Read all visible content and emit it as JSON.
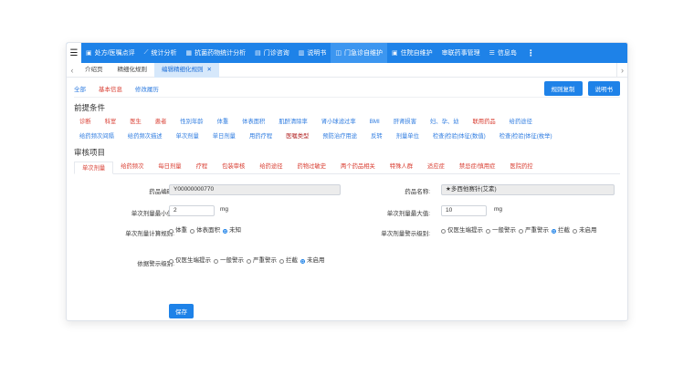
{
  "nav": {
    "items": [
      {
        "icon": "prescription-icon",
        "glyph": "▣",
        "label": "处方/医嘱点评"
      },
      {
        "icon": "chart-icon",
        "glyph": "⟋",
        "label": "统计分析"
      },
      {
        "icon": "antibiotic-icon",
        "glyph": "▦",
        "label": "抗菌药物统计分析"
      },
      {
        "icon": "clinic-icon",
        "glyph": "▤",
        "label": "门诊咨询"
      },
      {
        "icon": "manual-icon",
        "glyph": "▥",
        "label": "说明书"
      },
      {
        "icon": "outpatient-icon",
        "glyph": "◫",
        "label": "门急诊自维护"
      },
      {
        "icon": "inpatient-icon",
        "glyph": "▣",
        "label": "住院自维护"
      },
      {
        "icon": "none",
        "glyph": "",
        "label": "审联药事管理"
      },
      {
        "icon": "info-icon",
        "glyph": "☰",
        "label": "信息岛"
      }
    ],
    "more": "⋮"
  },
  "tabs": [
    {
      "label": "介绍页"
    },
    {
      "label": "精细化规则"
    },
    {
      "label": "编辑精细化规则",
      "close": "✕"
    }
  ],
  "toplinks": {
    "all": "全部",
    "basic": "基本信息",
    "history": "修改履历"
  },
  "buttons": {
    "copy": "规则复制",
    "manual": "说明书",
    "save": "保存"
  },
  "preconditions": {
    "title": "前提条件",
    "row1": [
      {
        "label": "诊断",
        "color": "red"
      },
      {
        "label": "科室",
        "color": "red"
      },
      {
        "label": "医生",
        "color": "red"
      },
      {
        "label": "患者",
        "color": "red"
      },
      {
        "label": "性别年龄",
        "color": "blue"
      },
      {
        "label": "体重",
        "color": "blue"
      },
      {
        "label": "体表面积",
        "color": "blue"
      },
      {
        "label": "肌酐清除率",
        "color": "blue"
      },
      {
        "label": "肾小球滤过率",
        "color": "blue"
      },
      {
        "label": "BMI",
        "color": "blue"
      },
      {
        "label": "肝肾损害",
        "color": "blue"
      },
      {
        "label": "妇、孕、幼",
        "color": "blue"
      },
      {
        "label": "联用药品",
        "color": "red"
      },
      {
        "label": "给药途径",
        "color": "blue"
      }
    ],
    "row2": [
      {
        "label": "给药频次间隔",
        "color": "blue"
      },
      {
        "label": "给药频次描述",
        "color": "blue"
      },
      {
        "label": "单次剂量",
        "color": "blue"
      },
      {
        "label": "单日剂量",
        "color": "blue"
      },
      {
        "label": "用药疗程",
        "color": "blue"
      },
      {
        "label": "医嘱类型",
        "color": "darkred"
      },
      {
        "label": "预防治疗用途",
        "color": "blue"
      },
      {
        "label": "反转",
        "color": "blue"
      },
      {
        "label": "剂量单位",
        "color": "blue"
      },
      {
        "label": "检查|检验|体征(数值)",
        "color": "blue"
      },
      {
        "label": "检查|检验|体征(枚举)",
        "color": "blue"
      }
    ]
  },
  "review": {
    "title": "审核项目",
    "tabs": [
      "单次剂量",
      "给药频次",
      "每日剂量",
      "疗程",
      "包装审核",
      "给药途径",
      "药物过敏史",
      "两个药品相关",
      "特殊人群",
      "适应症",
      "禁忌症/慎用症",
      "医院药控"
    ]
  },
  "form": {
    "drug_code_label": "药品编码:",
    "drug_code": "Y00000000770",
    "drug_name_label": "药品名称:",
    "drug_name": "★多西他赛针(艾素)",
    "min_label": "单次剂量最小值:",
    "min_value": "2",
    "min_unit": "mg",
    "max_label": "单次剂量最大值:",
    "max_value": "10",
    "max_unit": "mg",
    "calc_label": "单次剂量计算规则:",
    "calc_options": [
      {
        "label": "体重",
        "checked": false
      },
      {
        "label": "体表面积",
        "checked": false
      },
      {
        "label": "未知",
        "checked": true
      }
    ],
    "warn_label": "单次剂量警示级别:",
    "warn_options": [
      {
        "label": "仅医生端提示",
        "checked": false
      },
      {
        "label": "一般警示",
        "checked": false
      },
      {
        "label": "严重警示",
        "checked": false
      },
      {
        "label": "拦截",
        "checked": true
      },
      {
        "label": "未启用",
        "checked": false
      }
    ],
    "base_warn_label": "依据警示级别:",
    "base_warn_options": [
      {
        "label": "仅医生端提示",
        "checked": false
      },
      {
        "label": "一般警示",
        "checked": false
      },
      {
        "label": "严重警示",
        "checked": false
      },
      {
        "label": "拦截",
        "checked": false
      },
      {
        "label": "未启用",
        "checked": true
      }
    ]
  },
  "colors": {
    "primary": "#1e82e8",
    "red": "#d83b2f",
    "blue": "#2d7be0",
    "darkred": "#b02020"
  }
}
